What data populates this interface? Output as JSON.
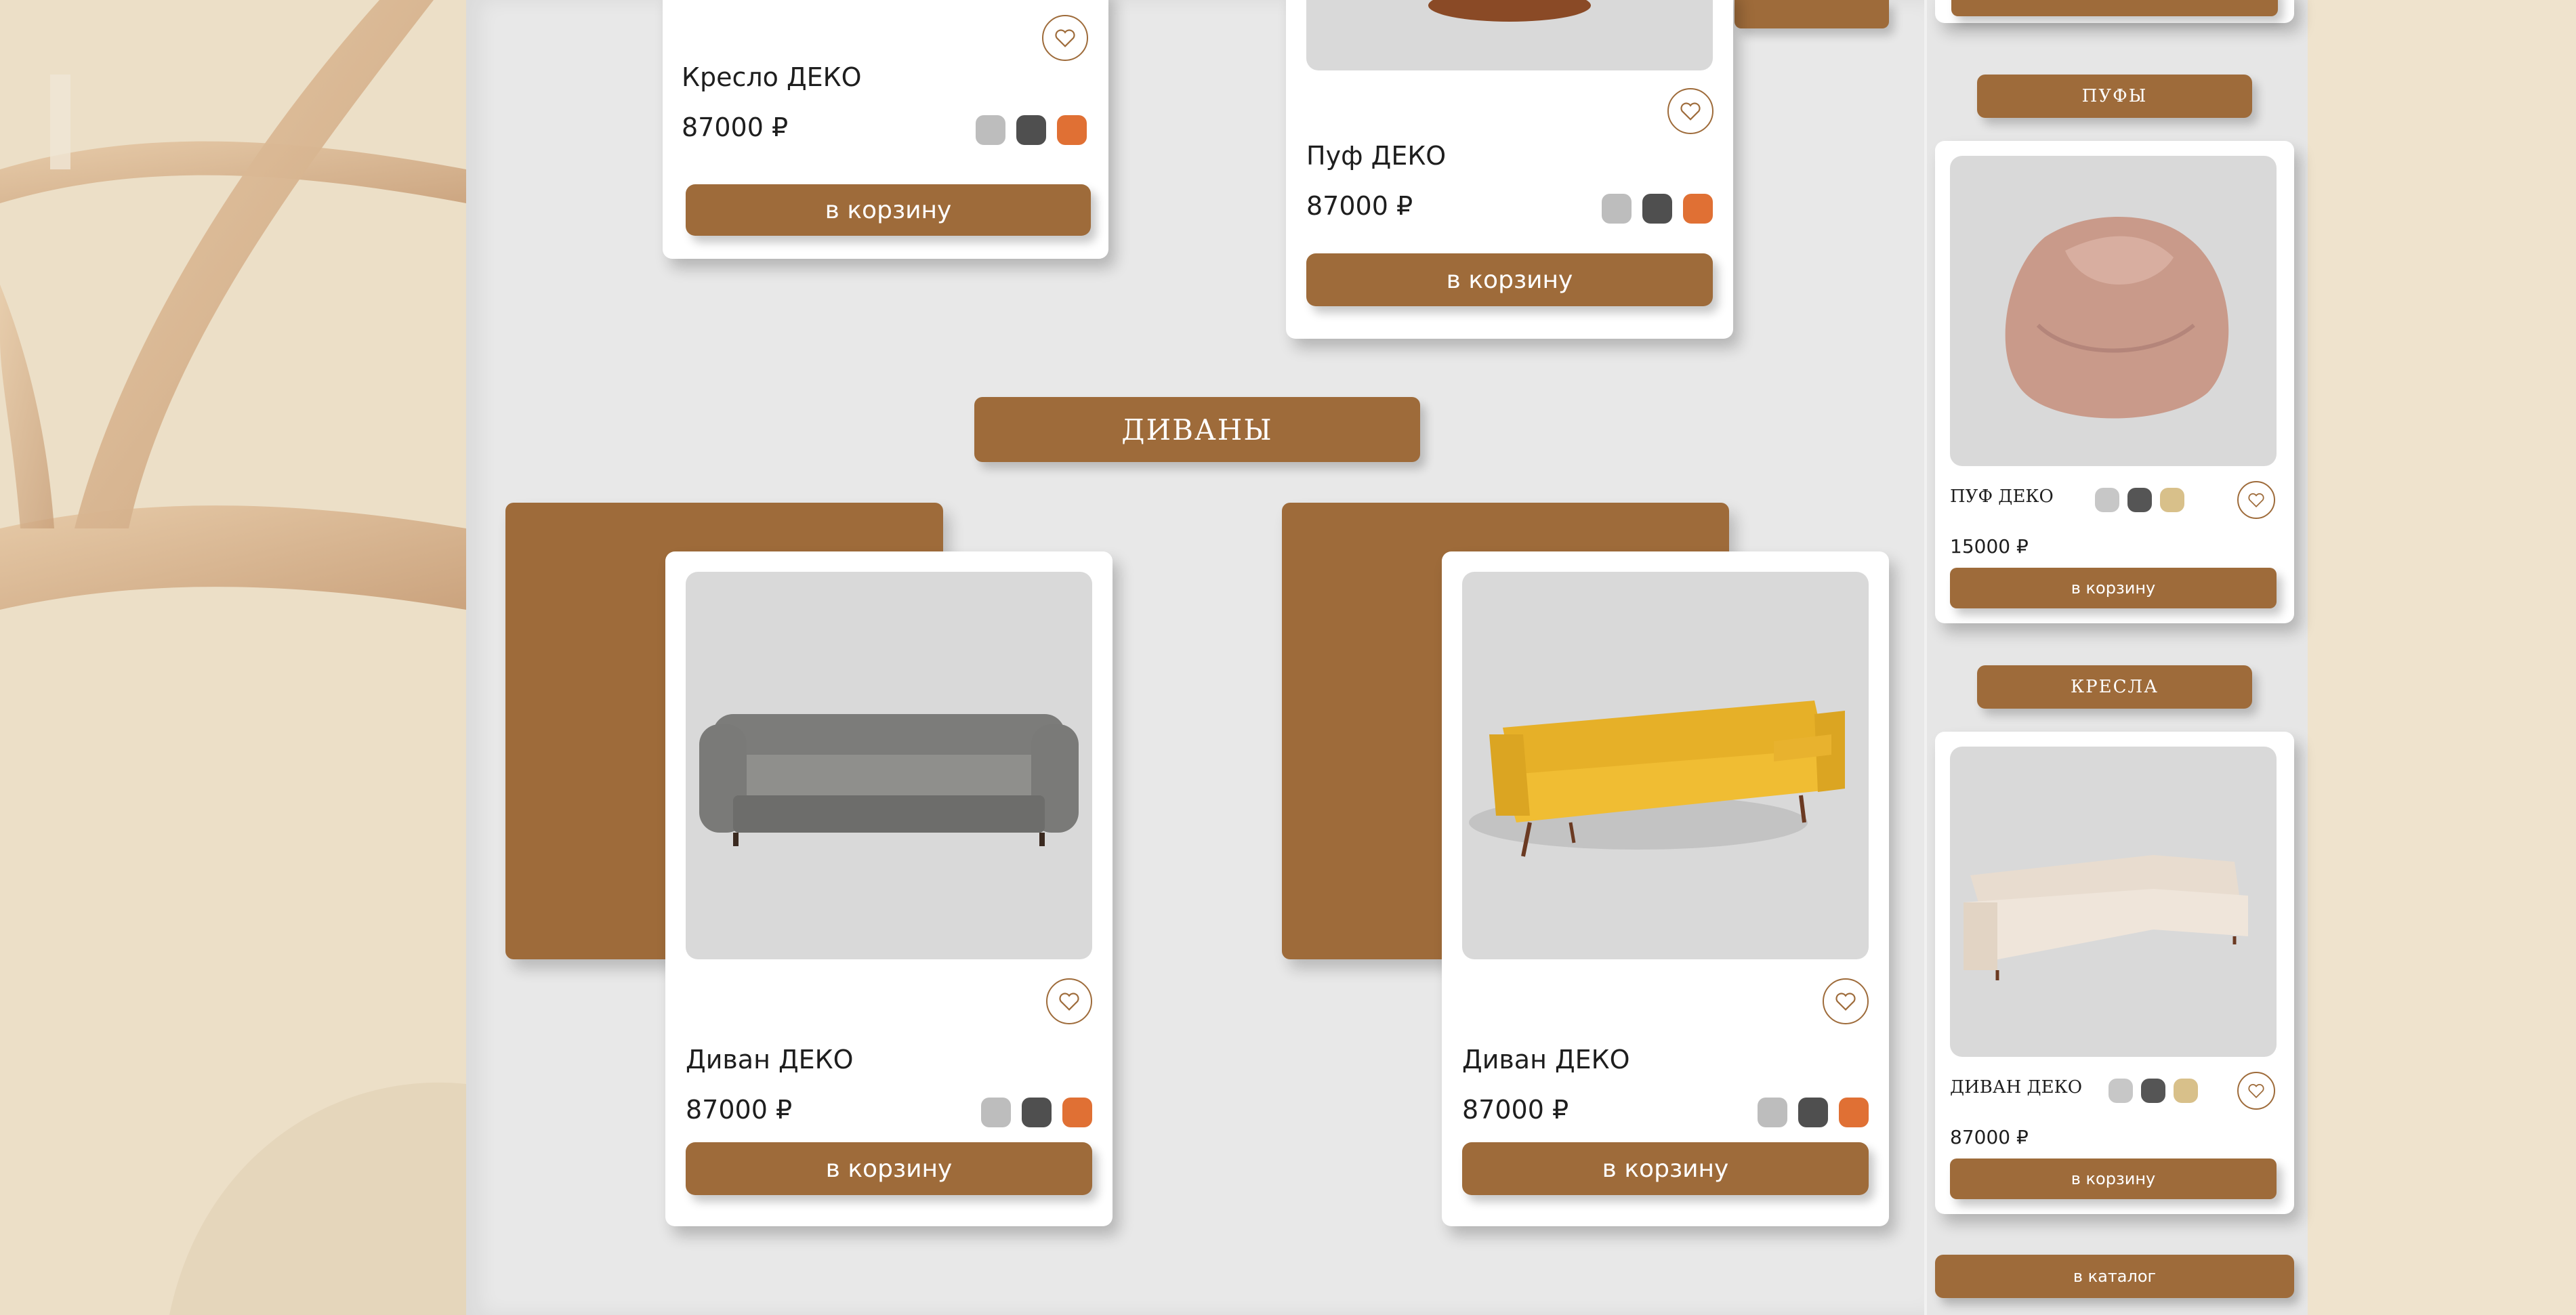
{
  "main": {
    "top_left_card": {
      "title": "Кресло ДЕКО",
      "price": "87000 ₽",
      "button": "в корзину"
    },
    "top_right_card": {
      "title": "Пуф ДЕКО",
      "price": "87000 ₽",
      "button": "в корзину"
    },
    "section_title": "ДИВАНЫ",
    "sofa_cards": [
      {
        "title": "Диван ДЕКО",
        "price": "87000 ₽",
        "button": "в корзину",
        "image": "grey-chesterfield-sofa"
      },
      {
        "title": "Диван ДЕКО",
        "price": "87000 ₽",
        "button": "в корзину",
        "image": "yellow-mid-century-sofa"
      }
    ],
    "swatches": [
      "#bdbdbd",
      "#4f4f4f",
      "#e07034"
    ]
  },
  "sidebar": {
    "poufs_label": "ПУФЫ",
    "armchairs_label": "КРЕСЛА",
    "pouf_card": {
      "title": "ПУФ ДЕКО",
      "price": "15000 ₽",
      "button": "в корзину"
    },
    "sofa_card": {
      "title": "ДИВАН ДЕКО",
      "price": "87000 ₽",
      "button": "в корзину"
    },
    "catalog_button": "в каталог",
    "swatches": [
      "#c7c7c7",
      "#555555",
      "#d8c08a"
    ]
  },
  "colors": {
    "accent": "#9e6b3a",
    "panel": "#e8e8e8",
    "background": "#efe3cd"
  }
}
